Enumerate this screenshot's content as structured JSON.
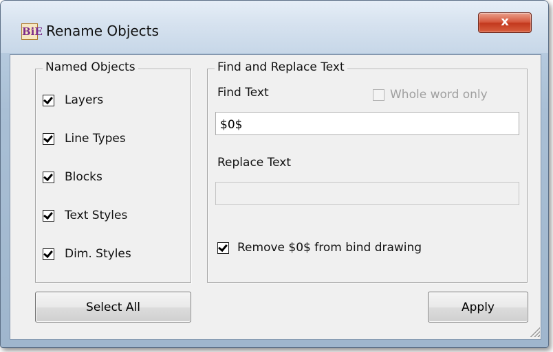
{
  "window": {
    "title": "Rename Objects",
    "logo_text": "BiE",
    "close_label": "x"
  },
  "named_objects": {
    "title": "Named Objects",
    "items": [
      {
        "label": "Layers",
        "checked": true
      },
      {
        "label": "Line Types",
        "checked": true
      },
      {
        "label": "Blocks",
        "checked": true
      },
      {
        "label": "Text Styles",
        "checked": true
      },
      {
        "label": "Dim. Styles",
        "checked": true
      }
    ]
  },
  "find_replace": {
    "title": "Find and Replace Text",
    "find_label": "Find Text",
    "find_value": "$0$",
    "whole_word_label": "Whole word only",
    "whole_word_checked": false,
    "whole_word_enabled": false,
    "replace_label": "Replace Text",
    "replace_value": "",
    "remove_label": "Remove $0$ from bind drawing",
    "remove_checked": true
  },
  "buttons": {
    "select_all": "Select All",
    "apply": "Apply"
  },
  "colors": {
    "close_button": "#c2371d",
    "frame": "#b8cce0",
    "client": "#f0f0f0"
  }
}
